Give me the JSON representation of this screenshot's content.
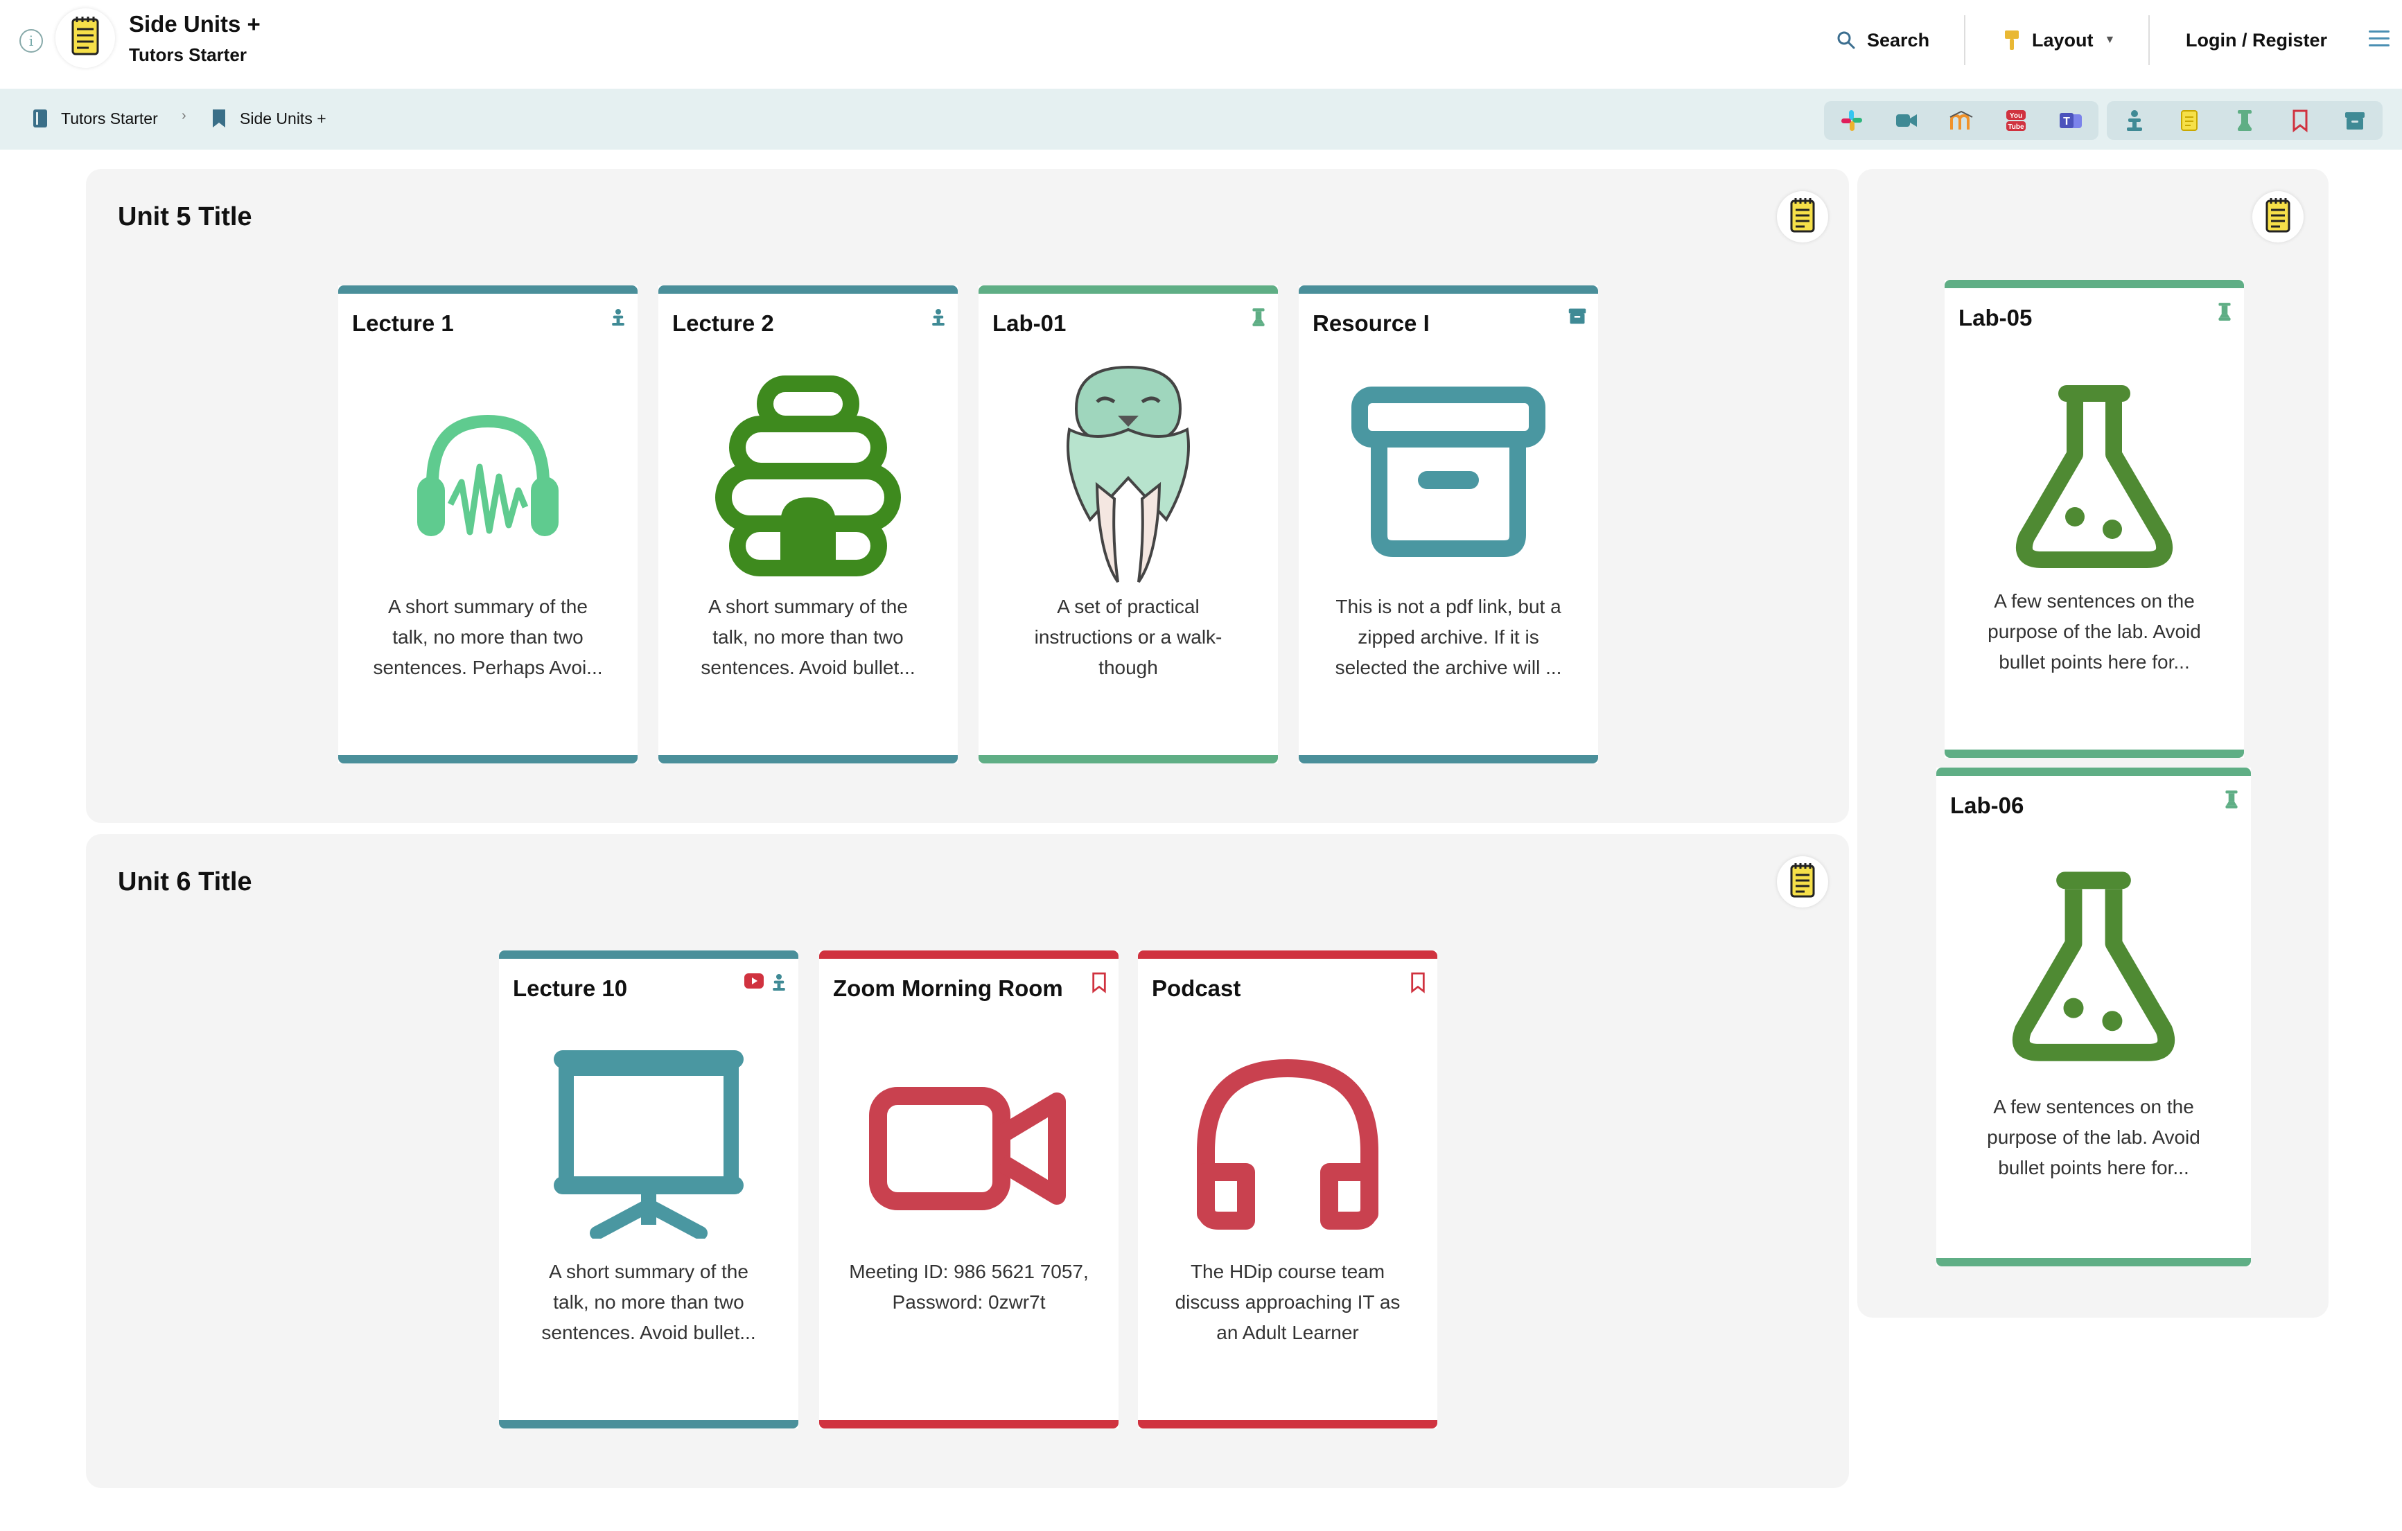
{
  "header": {
    "title": "Side Units +",
    "subtitle": "Tutors Starter",
    "search_label": "Search",
    "layout_label": "Layout",
    "login_label": "Login / Register"
  },
  "breadcrumb": [
    {
      "label": "Tutors Starter"
    },
    {
      "label": "Side Units +"
    }
  ],
  "toolbar": {
    "group1": [
      "slack-icon",
      "video-icon",
      "moodle-icon",
      "youtube-icon",
      "teams-icon"
    ],
    "group2": [
      "lecture-icon",
      "note-icon",
      "lab-icon",
      "bookmark-icon",
      "archive-icon"
    ]
  },
  "colors": {
    "teal": "#4a8f9a",
    "green": "#5fae85",
    "red": "#d0323f",
    "dark_green": "#3e8a1e",
    "lab_green": "#4f8a33",
    "note_yellow": "#f6e049"
  },
  "units": [
    {
      "title": "Unit 5 Title",
      "cards": [
        {
          "title": "Lecture 1",
          "summary_lines": [
            "A short summary of the",
            "talk, no more than two",
            "sentences. Perhaps Avoi..."
          ]
        },
        {
          "title": "Lecture 2",
          "summary_lines": [
            "A short summary of the",
            "talk, no more than two",
            "sentences. Avoid bullet..."
          ]
        },
        {
          "title": "Lab-01",
          "summary_lines": [
            "A set of practical",
            "instructions or a walk-",
            "though"
          ]
        },
        {
          "title": "Resource I",
          "summary_lines": [
            "This is not a pdf link, but a",
            "zipped archive. If it is",
            "selected the archive will ..."
          ]
        }
      ]
    },
    {
      "title": "Unit 6 Title",
      "cards": [
        {
          "title": "Lecture 10",
          "summary_lines": [
            "A short summary of the",
            "talk, no more than two",
            "sentences. Avoid bullet..."
          ]
        },
        {
          "title": "Zoom Morning Room",
          "summary_lines": [
            "Meeting ID: 986 5621 7057,",
            "Password: 0zwr7t"
          ]
        },
        {
          "title": "Podcast",
          "summary_lines": [
            "The HDip course team",
            "discuss approaching IT as",
            "an Adult Learner"
          ]
        }
      ]
    }
  ],
  "side_unit": {
    "cards": [
      {
        "title": "Lab-05",
        "summary_lines": [
          "A few sentences on the",
          "purpose of the lab. Avoid",
          "bullet points here for..."
        ]
      },
      {
        "title": "Lab-06",
        "summary_lines": [
          "A few sentences on the",
          "purpose of the lab. Avoid",
          "bullet points here for..."
        ]
      }
    ]
  }
}
